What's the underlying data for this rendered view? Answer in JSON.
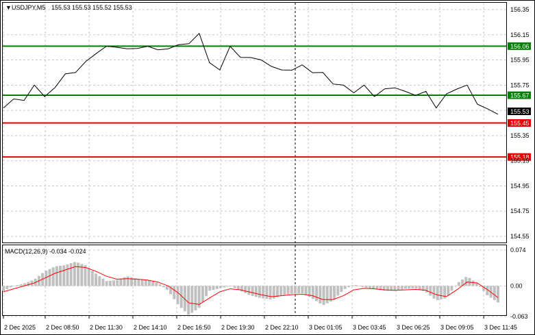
{
  "header": {
    "symbol": "USDJPY,M5",
    "ohlc": "155.53 155.53 155.52 155.53"
  },
  "price_axis": {
    "ticks": [
      "156.35",
      "156.15",
      "155.95",
      "155.75",
      "155.55",
      "155.35",
      "155.15",
      "154.95",
      "154.75",
      "154.55"
    ]
  },
  "levels": [
    {
      "price": 156.06,
      "label": "156.06",
      "color": "#008000",
      "kind": "resistance"
    },
    {
      "price": 155.67,
      "label": "155.67",
      "color": "#008000",
      "kind": "resistance"
    },
    {
      "price": 155.45,
      "label": "155.45",
      "color": "#e00000",
      "kind": "support"
    },
    {
      "price": 155.18,
      "label": "155.18",
      "color": "#e00000",
      "kind": "support"
    }
  ],
  "current_price": {
    "label": "155.53",
    "price": 155.53
  },
  "macd": {
    "title": "MACD(12,26,9) -0.034 -0.024",
    "ticks": [
      "0.074",
      "0.00",
      "-0.063"
    ]
  },
  "time_axis": {
    "labels": [
      "2 Dec 2025",
      "2 Dec 08:50",
      "2 Dec 11:30",
      "2 Dec 14:10",
      "2 Dec 16:50",
      "2 Dec 19:30",
      "2 Dec 22:10",
      "3 Dec 01:05",
      "3 Dec 03:45",
      "3 Dec 06:25",
      "3 Dec 09:05",
      "3 Dec 11:45"
    ]
  },
  "colors": {
    "grid": "#c8c8c8",
    "price_line": "#000000",
    "macd_hist": "#c0c0c0",
    "macd_signal": "#ff0000",
    "label_text_on_color": "#ffffff",
    "current_bg": "#000000"
  },
  "chart_data": {
    "type": "line",
    "title": "USDJPY,M5",
    "ylim": [
      154.5,
      156.4
    ],
    "series": [
      {
        "name": "USDJPY,M5",
        "values": [
          155.58,
          155.63,
          155.64,
          155.74,
          155.67,
          155.72,
          155.85,
          155.84,
          155.95,
          155.99,
          156.07,
          156.04,
          156.05,
          156.03,
          156.07,
          156.02,
          156.05,
          156.06,
          156.09,
          156.15,
          155.94,
          155.86,
          156.07,
          155.96,
          155.98,
          155.94,
          155.91,
          155.86,
          155.88,
          155.9,
          155.86,
          155.84,
          155.77,
          155.74,
          155.7,
          155.74,
          155.67,
          155.71,
          155.74,
          155.69,
          155.68,
          155.69,
          155.58,
          155.67,
          155.73,
          155.74,
          155.61,
          155.55,
          155.53
        ]
      },
      {
        "name": "MACD(12,26,9)",
        "values": [
          -0.01,
          0.0,
          0.005,
          0.013,
          0.03,
          0.04,
          0.043,
          0.05,
          0.042,
          0.025,
          0.01,
          0.012,
          0.02,
          0.015,
          0.012,
          0.006,
          -0.01,
          -0.04,
          -0.06,
          -0.045,
          -0.01,
          -0.005,
          0.0,
          -0.01,
          -0.02,
          -0.025,
          -0.028,
          -0.02,
          -0.016,
          -0.015,
          -0.026,
          -0.04,
          -0.03,
          -0.008,
          0.003,
          -0.003,
          -0.006,
          -0.01,
          -0.01,
          -0.006,
          -0.005,
          -0.012,
          -0.03,
          -0.025,
          0.005,
          0.02,
          0.005,
          -0.02,
          -0.034
        ]
      },
      {
        "name": "Signal",
        "values": [
          -0.012,
          -0.006,
          0.0,
          0.006,
          0.016,
          0.026,
          0.033,
          0.04,
          0.038,
          0.03,
          0.02,
          0.014,
          0.015,
          0.014,
          0.012,
          0.008,
          0.0,
          -0.015,
          -0.035,
          -0.038,
          -0.025,
          -0.012,
          -0.006,
          -0.008,
          -0.013,
          -0.018,
          -0.022,
          -0.02,
          -0.018,
          -0.017,
          -0.02,
          -0.028,
          -0.028,
          -0.02,
          -0.008,
          -0.005,
          -0.006,
          -0.008,
          -0.009,
          -0.008,
          -0.007,
          -0.009,
          -0.018,
          -0.022,
          -0.008,
          0.008,
          0.006,
          -0.008,
          -0.024
        ]
      }
    ],
    "macd_ylim": [
      -0.063,
      0.074
    ]
  }
}
